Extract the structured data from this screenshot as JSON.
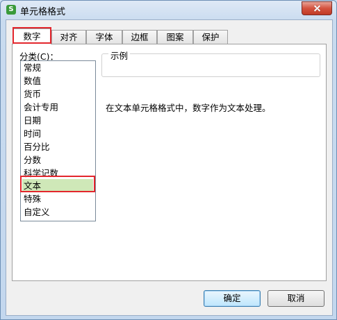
{
  "window": {
    "title": "单元格格式",
    "app_icon_letter": "S"
  },
  "tabs": [
    {
      "label": "数字",
      "active": true
    },
    {
      "label": "对齐",
      "active": false
    },
    {
      "label": "字体",
      "active": false
    },
    {
      "label": "边框",
      "active": false
    },
    {
      "label": "图案",
      "active": false
    },
    {
      "label": "保护",
      "active": false
    }
  ],
  "category": {
    "label": "分类(C)：",
    "items": [
      "常规",
      "数值",
      "货币",
      "会计专用",
      "日期",
      "时间",
      "百分比",
      "分数",
      "科学记数",
      "文本",
      "特殊",
      "自定义"
    ],
    "selected": "文本"
  },
  "sample": {
    "title": "示例"
  },
  "description": "在文本单元格格式中，数字作为文本处理。",
  "buttons": {
    "ok": "确定",
    "cancel": "取消"
  },
  "colors": {
    "highlight_border": "#e3262c",
    "selected_item_bg": "#cfe8b8"
  },
  "icons": {
    "app": "wps-spreadsheet-icon",
    "close": "close-icon"
  }
}
